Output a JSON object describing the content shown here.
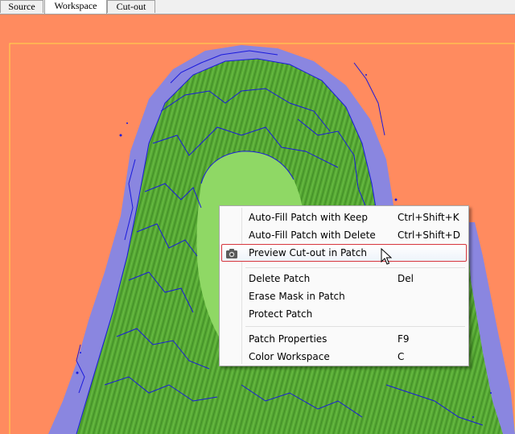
{
  "tabs": [
    {
      "label": "Source",
      "active": false
    },
    {
      "label": "Workspace",
      "active": true
    },
    {
      "label": "Cut-out",
      "active": false
    }
  ],
  "workspace": {
    "background_color": "#ff8b5f",
    "mask_color": "#8a86e0",
    "patch_color": "#62b83e",
    "outline_color": "#1a1adc",
    "selection_border_color": "#ffd84a"
  },
  "context_menu": {
    "items": [
      {
        "label": "Auto-Fill Patch with Keep",
        "shortcut": "Ctrl+Shift+K"
      },
      {
        "label": "Auto-Fill Patch with Delete",
        "shortcut": "Ctrl+Shift+D"
      },
      {
        "label": "Preview Cut-out in Patch",
        "shortcut": "",
        "icon": "camera-icon",
        "highlighted": true
      },
      {
        "label": "Delete Patch",
        "shortcut": "Del"
      },
      {
        "label": "Erase Mask in Patch",
        "shortcut": ""
      },
      {
        "label": "Protect Patch",
        "shortcut": ""
      },
      {
        "label": "Patch Properties",
        "shortcut": "F9"
      },
      {
        "label": "Color Workspace",
        "shortcut": "C"
      }
    ]
  }
}
